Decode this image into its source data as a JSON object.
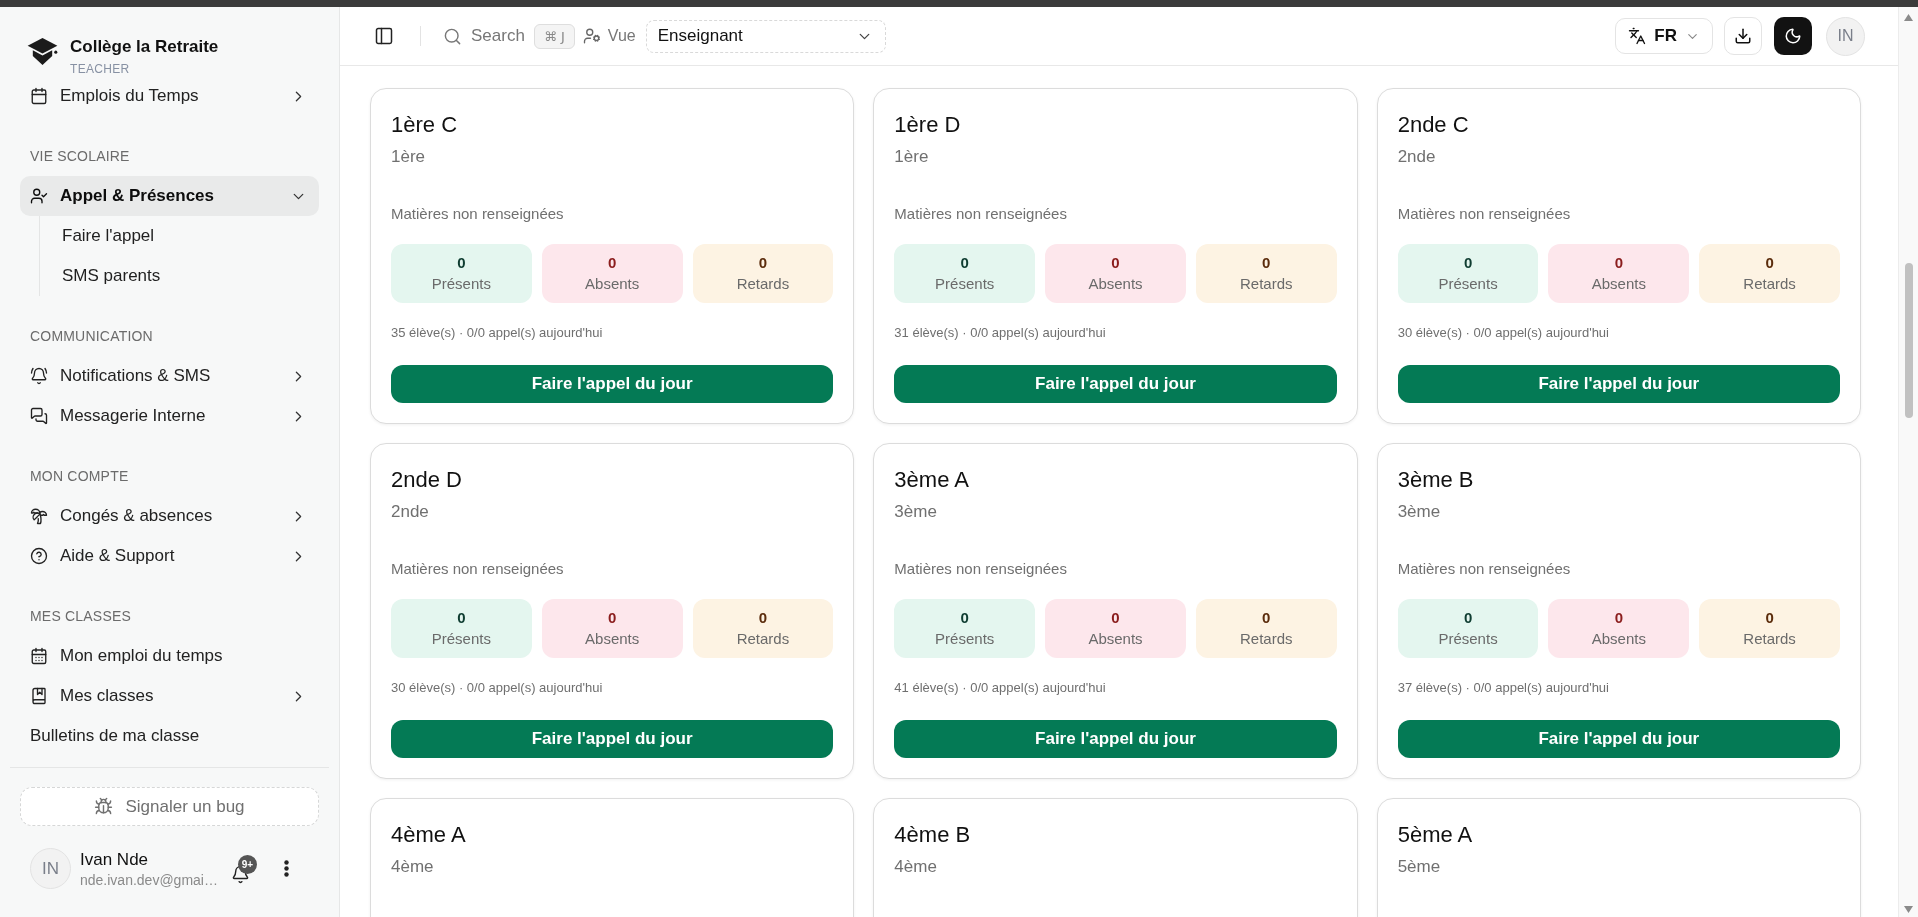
{
  "sidebar": {
    "brand": {
      "name": "Collège la Retraite",
      "role": "TEACHER"
    },
    "sections": [
      {
        "items": [
          {
            "label": "Emplois du Temps",
            "kind": "menu",
            "expanded": false,
            "selected": false
          }
        ]
      },
      {
        "title": "VIE SCOLAIRE",
        "items": [
          {
            "label": "Appel & Présences",
            "kind": "menu",
            "expanded": true,
            "selected": true,
            "children": [
              {
                "label": "Faire l'appel",
                "selected": false
              },
              {
                "label": "SMS parents",
                "selected": false
              }
            ]
          }
        ]
      },
      {
        "title": "COMMUNICATION",
        "items": [
          {
            "label": "Notifications & SMS",
            "kind": "menu",
            "expanded": false,
            "selected": false
          },
          {
            "label": "Messagerie Interne",
            "kind": "menu",
            "expanded": false,
            "selected": false
          }
        ]
      },
      {
        "title": "MON COMPTE",
        "items": [
          {
            "label": "Congés & absences",
            "kind": "menu",
            "expanded": false,
            "selected": false
          },
          {
            "label": "Aide & Support",
            "kind": "menu",
            "expanded": false,
            "selected": false
          }
        ]
      },
      {
        "title": "MES CLASSES",
        "items": [
          {
            "label": "Mon emploi du temps",
            "kind": "link",
            "selected": false
          },
          {
            "label": "Mes classes",
            "kind": "menu",
            "expanded": false,
            "selected": false
          },
          {
            "label": "Bulletins de ma classe",
            "kind": "link",
            "selected": false
          }
        ]
      }
    ],
    "bug_button": "Signaler un bug",
    "user": {
      "initials": "IN",
      "name": "Ivan Nde",
      "email": "nde.ivan.dev@gmai…",
      "notification_badge": "9+"
    }
  },
  "header": {
    "search": {
      "label": "Search",
      "shortcut": "⌘ J"
    },
    "view": {
      "label": "Vue",
      "value": "Enseignant"
    },
    "language": "FR",
    "avatar": "IN"
  },
  "classes": [
    {
      "name": "1ère C",
      "grade": "1ère",
      "subjects": "Matières non renseignées",
      "stats": [
        {
          "kind": "present",
          "value": "0",
          "label": "Présents"
        },
        {
          "kind": "absent",
          "value": "0",
          "label": "Absents"
        },
        {
          "kind": "late",
          "value": "0",
          "label": "Retards"
        }
      ],
      "summary": "35 élève(s) · 0/0 appel(s) aujourd'hui",
      "action": "Faire l'appel du jour"
    },
    {
      "name": "1ère D",
      "grade": "1ère",
      "subjects": "Matières non renseignées",
      "stats": [
        {
          "kind": "present",
          "value": "0",
          "label": "Présents"
        },
        {
          "kind": "absent",
          "value": "0",
          "label": "Absents"
        },
        {
          "kind": "late",
          "value": "0",
          "label": "Retards"
        }
      ],
      "summary": "31 élève(s) · 0/0 appel(s) aujourd'hui",
      "action": "Faire l'appel du jour"
    },
    {
      "name": "2nde C",
      "grade": "2nde",
      "subjects": "Matières non renseignées",
      "stats": [
        {
          "kind": "present",
          "value": "0",
          "label": "Présents"
        },
        {
          "kind": "absent",
          "value": "0",
          "label": "Absents"
        },
        {
          "kind": "late",
          "value": "0",
          "label": "Retards"
        }
      ],
      "summary": "30 élève(s) · 0/0 appel(s) aujourd'hui",
      "action": "Faire l'appel du jour"
    },
    {
      "name": "2nde D",
      "grade": "2nde",
      "subjects": "Matières non renseignées",
      "stats": [
        {
          "kind": "present",
          "value": "0",
          "label": "Présents"
        },
        {
          "kind": "absent",
          "value": "0",
          "label": "Absents"
        },
        {
          "kind": "late",
          "value": "0",
          "label": "Retards"
        }
      ],
      "summary": "30 élève(s) · 0/0 appel(s) aujourd'hui",
      "action": "Faire l'appel du jour"
    },
    {
      "name": "3ème A",
      "grade": "3ème",
      "subjects": "Matières non renseignées",
      "stats": [
        {
          "kind": "present",
          "value": "0",
          "label": "Présents"
        },
        {
          "kind": "absent",
          "value": "0",
          "label": "Absents"
        },
        {
          "kind": "late",
          "value": "0",
          "label": "Retards"
        }
      ],
      "summary": "41 élève(s) · 0/0 appel(s) aujourd'hui",
      "action": "Faire l'appel du jour"
    },
    {
      "name": "3ème B",
      "grade": "3ème",
      "subjects": "Matières non renseignées",
      "stats": [
        {
          "kind": "present",
          "value": "0",
          "label": "Présents"
        },
        {
          "kind": "absent",
          "value": "0",
          "label": "Absents"
        },
        {
          "kind": "late",
          "value": "0",
          "label": "Retards"
        }
      ],
      "summary": "37 élève(s) · 0/0 appel(s) aujourd'hui",
      "action": "Faire l'appel du jour"
    },
    {
      "name": "4ème A",
      "grade": "4ème"
    },
    {
      "name": "4ème B",
      "grade": "4ème"
    },
    {
      "name": "5ème A",
      "grade": "5ème"
    }
  ]
}
